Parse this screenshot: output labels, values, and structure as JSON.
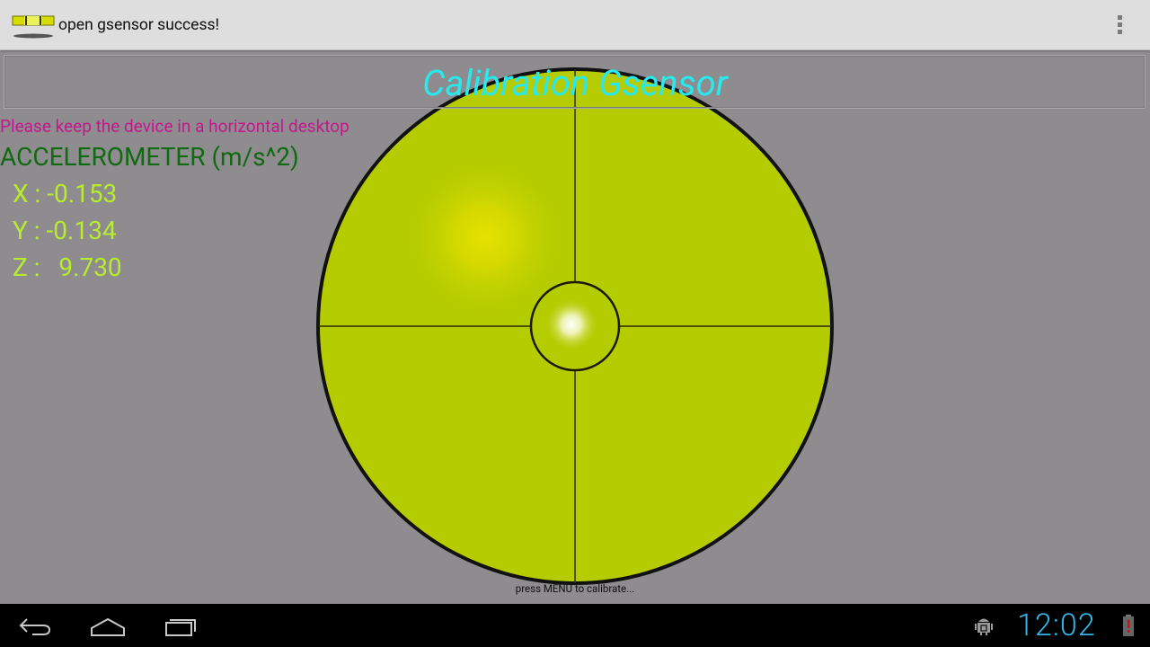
{
  "action_bar": {
    "title": "open gsensor success!",
    "icons": [
      "app-level-icon",
      "overflow-menu-icon"
    ]
  },
  "main": {
    "title": "Calibration Gsensor",
    "hint": "Please keep the device in a horizontal desktop",
    "sensor_label": "ACCELEROMETER (m/s^2)",
    "readings": [
      {
        "axis": "X",
        "text": "X : -0.153",
        "value": -0.153
      },
      {
        "axis": "Y",
        "text": "Y : -0.134",
        "value": -0.134
      },
      {
        "axis": "Z",
        "text": "Z :   9.730",
        "value": 9.73
      }
    ],
    "calibrate_hint": "press MENU to calibrate..."
  },
  "nav_bar": {
    "buttons": [
      "back-icon",
      "home-icon",
      "recent-apps-icon"
    ],
    "status_icons": [
      "usb-debugging-icon",
      "battery-low-icon"
    ],
    "clock": "12:02"
  },
  "colors": {
    "background": "#8e8c8e",
    "title": "#29e8ee",
    "hint": "#c2188e",
    "sensor_label": "#0f6a12",
    "readings": "#b9ec2c",
    "level_disc": "#b5cc00",
    "bubble": "#e6e200",
    "clock": "#33b5e5"
  }
}
